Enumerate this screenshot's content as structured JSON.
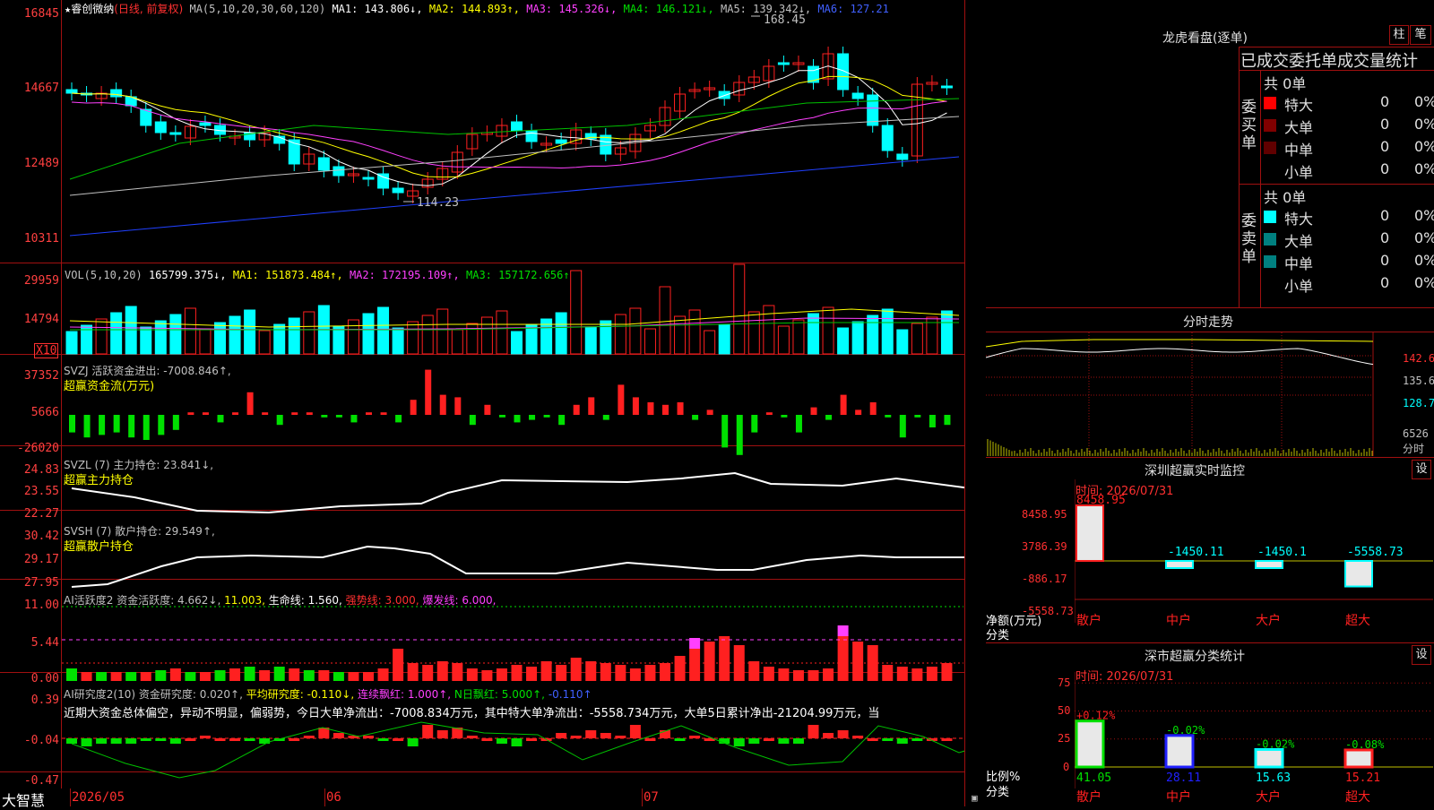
{
  "colors": {
    "up": "#ff2020",
    "down": "#00ffff",
    "bg": "#000000",
    "frame": "#a01010"
  },
  "main": {
    "title": "睿创微纳",
    "title_mode": "(日线, 前复权)",
    "star": "★",
    "ma_prefix": "MA(5,10,20,30,60,120)",
    "ma1": "MA1: 143.806↓,",
    "ma2": "MA2: 144.893↑,",
    "ma3": "MA3: 145.326↓,",
    "ma4": "MA4: 146.121↓,",
    "ma5": "MA5: 139.342↓,",
    "ma6": "MA6: 127.21",
    "y_labels": [
      "16845",
      "14667",
      "12489",
      "10311"
    ],
    "high_marker": "168.45",
    "low_marker": "114.23"
  },
  "vol": {
    "label": "VOL(5,10,20)",
    "value": "165799.375↓,",
    "ma1": "MA1: 151873.484↑,",
    "ma2": "MA2: 172195.109↑,",
    "ma3": "MA3: 157172.656↑",
    "y_labels": [
      "29959",
      "14794"
    ],
    "unit": "X10"
  },
  "svzj": {
    "label": "SVZJ  活跃资金进出: -7008.846↑,",
    "sub": "超赢资金流(万元)",
    "y_labels": [
      "37352",
      "5666",
      "-26020"
    ]
  },
  "svzl": {
    "label": "SVZL (7) 主力持仓: 23.841↓,",
    "sub": "超赢主力持仓",
    "y_labels": [
      "24.83",
      "23.55",
      "22.27"
    ]
  },
  "svsh": {
    "label": "SVSH (7) 散户持仓: 29.549↑,",
    "sub": "超赢散户持仓",
    "y_labels": [
      "30.42",
      "29.17",
      "27.95"
    ]
  },
  "ai1": {
    "label": "AI活跃度2 资金活跃度: 4.662↓,",
    "v2": "11.003,",
    "v3": "生命线: 1.560,",
    "v4": "强势线: 3.000,",
    "v5": "爆发线: 6.000,",
    "y_labels": [
      "11.00",
      "5.44",
      "0.00"
    ]
  },
  "ai2": {
    "label": "AI研究度2(10) 资金研究度: 0.020↑,",
    "v2": "平均研究度: -0.110↓,",
    "v3": "连续飘红: 1.000↑,",
    "v4": "N日飘红: 5.000↑,",
    "v5": "-0.110↑",
    "commentary": "近期大资金总体偏空，异动不明显，偏弱势，今日大单净流出：-7008.834万元，其中特大单净流出：-5558.734万元，大单5日累计净出-21204.99万元，当",
    "y_labels": [
      "0.39",
      "-0.04",
      "-0.47"
    ]
  },
  "xaxis": {
    "labels": [
      "2026/05",
      "06",
      "07"
    ],
    "brand": "大智慧"
  },
  "lhb": {
    "title": "龙虎看盘(逐单)",
    "btn1": "柱",
    "btn2": "笔",
    "header": "已成交委托单成交量统计",
    "buy_side": "委买单",
    "sell_side": "委卖单",
    "buy_total": "共 0单",
    "sell_total": "共 0单",
    "buy_rows": [
      {
        "name": "特大",
        "count": "0",
        "pct": "0%",
        "color": "#ff0000"
      },
      {
        "name": "大单",
        "count": "0",
        "pct": "0%",
        "color": "#800000"
      },
      {
        "name": "中单",
        "count": "0",
        "pct": "0%",
        "color": "#600000"
      },
      {
        "name": "小单",
        "count": "0",
        "pct": "0%",
        "color": "#000000"
      }
    ],
    "sell_rows": [
      {
        "name": "特大",
        "count": "0",
        "pct": "0%",
        "color": "#00ffff"
      },
      {
        "name": "大单",
        "count": "0",
        "pct": "0%",
        "color": "#008080"
      },
      {
        "name": "中单",
        "count": "0",
        "pct": "0%",
        "color": "#008080"
      },
      {
        "name": "小单",
        "count": "0",
        "pct": "0%",
        "color": "#000000"
      }
    ]
  },
  "intraday": {
    "title": "分时走势",
    "price_labels": [
      "142.6",
      "135.6",
      "128.7"
    ],
    "vol_label": "6526",
    "corner": "分时"
  },
  "sz_monitor": {
    "title": "深圳超赢实时监控",
    "settings": "设",
    "time": "时间: 2026/07/31",
    "y_labels": [
      "8458.95",
      "3786.39",
      "-886.17",
      "-5558.73"
    ],
    "axis_unit": "净额(万元)",
    "axis_cat": "分类",
    "bars": [
      {
        "cat": "散户",
        "value": "8458.95"
      },
      {
        "cat": "中户",
        "value": "-1450.11"
      },
      {
        "cat": "大户",
        "value": "-1450.1"
      },
      {
        "cat": "超大",
        "value": "-5558.73"
      }
    ]
  },
  "sz_class": {
    "title": "深市超赢分类统计",
    "settings": "设",
    "time": "时间: 2026/07/31",
    "y_labels": [
      "75",
      "50",
      "25",
      "0"
    ],
    "axis_unit": "比例%",
    "axis_cat": "分类",
    "bars": [
      {
        "cat": "散户",
        "pct": "41.05",
        "chg": "+0.12%"
      },
      {
        "cat": "中户",
        "pct": "28.11",
        "chg": "-0.02%"
      },
      {
        "cat": "大户",
        "pct": "15.63",
        "chg": "-0.02%"
      },
      {
        "cat": "超大",
        "pct": "15.21",
        "chg": "-0.08%"
      }
    ]
  }
}
